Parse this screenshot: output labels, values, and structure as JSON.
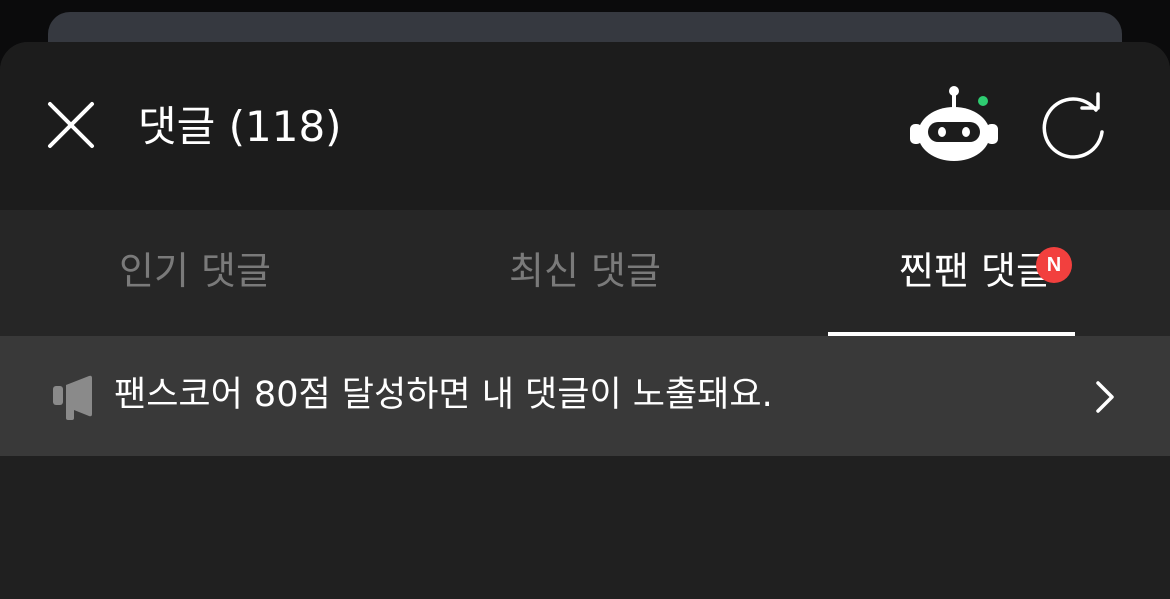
{
  "header": {
    "title": "댓글 (118)",
    "close_icon": "close-icon",
    "bot_icon": "robot-icon",
    "refresh_icon": "refresh-icon"
  },
  "tabs": [
    {
      "label": "인기 댓글",
      "active": false
    },
    {
      "label": "최신 댓글",
      "active": false
    },
    {
      "label": "찐팬 댓글",
      "active": true,
      "badge": "N"
    }
  ],
  "notice": {
    "icon": "megaphone-icon",
    "text": "팬스코어 80점 달성하면 내 댓글이 노출돼요.",
    "chevron": "chevron-right-icon"
  },
  "colors": {
    "background": "#1c1c1c",
    "tab_bar": "#262626",
    "notice_bar": "#393939",
    "badge": "#f2403e",
    "bot_status_dot": "#2ecc71"
  }
}
